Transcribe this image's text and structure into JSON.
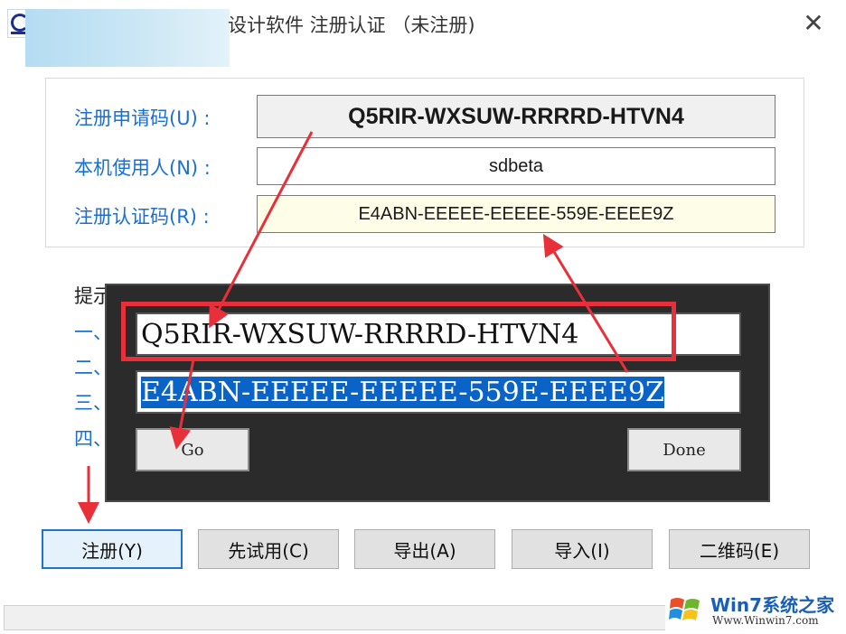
{
  "window": {
    "title": "设计软件 注册认证 （未注册)",
    "close_glyph": "✕"
  },
  "registration": {
    "apply_code_label": "注册申请码(U) :",
    "apply_code_value": "Q5RIR-WXSUW-RRRRD-HTVN4",
    "user_label": "本机使用人(N) :",
    "user_value": "sdbeta",
    "auth_code_label": "注册认证码(R) :",
    "auth_code_value": "E4ABN-EEEEE-EEEEE-559E-EEEE9Z"
  },
  "hints": {
    "title": "提示",
    "lines": [
      "一、",
      "二、",
      "三、",
      "四、"
    ]
  },
  "keygen": {
    "request_code": "Q5RIR-WXSUW-RRRRD-HTVN4",
    "generated_code": "E4ABN-EEEEE-EEEEE-559E-EEEE9Z",
    "go_label": "Go",
    "done_label": "Done"
  },
  "buttons": {
    "register": "注册(Y)",
    "trial": "先试用(C)",
    "export": "导出(A)",
    "import": "导入(I)",
    "qrcode": "二维码(E)"
  },
  "watermark": {
    "brand": "Win7系统之家",
    "url": "Www.Winwin7.com"
  },
  "colors": {
    "label_blue": "#1b6fd3",
    "annotation_red": "#e8303a",
    "selection_blue": "#0a64c8",
    "keygen_bg": "#2b2b2b"
  }
}
